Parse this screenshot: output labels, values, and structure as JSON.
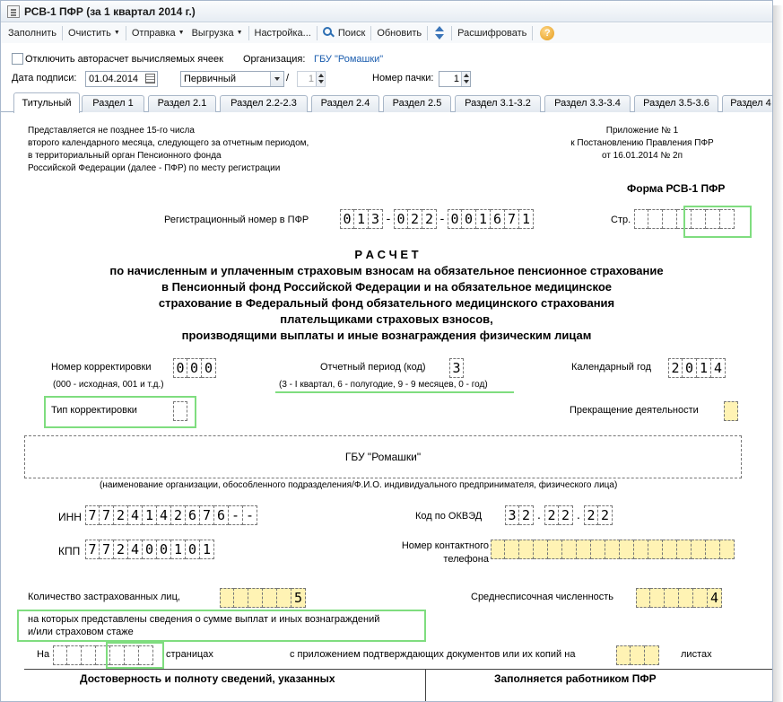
{
  "window": {
    "title": "РСВ-1 ПФР (за 1 квартал 2014 г.)"
  },
  "toolbar": {
    "fill": "Заполнить",
    "clear": "Очистить",
    "send": "Отправка",
    "export": "Выгрузка",
    "settings": "Настройка...",
    "search": "Поиск",
    "refresh": "Обновить",
    "decode": "Расшифровать"
  },
  "options": {
    "autocalc_label": "Отключить авторасчет вычисляемых ячеек",
    "org_label": "Организация:",
    "org_value": "ГБУ \"Ромашки\"",
    "sign_date_label": "Дата подписи:",
    "sign_date_value": "01.04.2014",
    "type_value": "Первичный",
    "type_sep": "/",
    "corr_num_value": "1",
    "pack_label": "Номер пачки:",
    "pack_value": "1"
  },
  "tabs": [
    "Титульный",
    "Раздел 1",
    "Раздел 2.1",
    "Раздел 2.2-2.3",
    "Раздел 2.4",
    "Раздел 2.5",
    "Раздел 3.1-3.2",
    "Раздел 3.3-3.4",
    "Раздел 3.5-3.6",
    "Раздел 4"
  ],
  "doc": {
    "note_lines": [
      "Представляется не позднее 15-го числа",
      "второго календарного месяца, следующего за отчетным периодом,",
      "в территориальный орган Пенсионного фонда",
      "Российской Федерации (далее - ПФР) по месту регистрации"
    ],
    "appendix_lines": [
      "Приложение № 1",
      "к Постановлению Правления ПФР",
      "от 16.01.2014 № 2п"
    ],
    "form_name": "Форма РСВ-1 ПФР",
    "reg_label": "Регистрационный номер в ПФР",
    "reg_digits": [
      [
        "0",
        "1",
        "3"
      ],
      [
        "0",
        "2",
        "2"
      ],
      [
        "0",
        "0",
        "1",
        "6",
        "7",
        "1"
      ]
    ],
    "reg_sep": "-",
    "page_label": "Стр.",
    "title_lines": [
      "Р А С Ч Е Т",
      "по начисленным и уплаченным страховым взносам на обязательное пенсионное страхование",
      "в Пенсионный фонд Российской Федерации и на обязательное медицинское",
      "страхование в Федеральный фонд обязательного медицинского страхования",
      "плательщиками страховых взносов,",
      "производящими выплаты и иные вознаграждения физическим лицам"
    ],
    "corr_num_label": "Номер корректировки",
    "corr_num_digits": [
      "0",
      "0",
      "0"
    ],
    "corr_hint": "(000 - исходная, 001 и т.д.)",
    "period_label": "Отчетный период (код)",
    "period_value": "3",
    "period_hint": "(3 - I квартал, 6 - полугодие, 9 - 9 месяцев, 0 - год)",
    "year_label": "Календарный год",
    "year_digits": [
      "2",
      "0",
      "1",
      "4"
    ],
    "corr_type_label": "Тип корректировки",
    "stop_label": "Прекращение деятельности",
    "org_name": "ГБУ \"Ромашки\"",
    "org_hint": "(наименование организации, обособленного подразделения/Ф.И.О. индивидуального предпринимателя, физического лица)",
    "inn_label": "ИНН",
    "inn_digits": [
      "7",
      "7",
      "2",
      "4",
      "1",
      "4",
      "2",
      "6",
      "7",
      "6",
      "-",
      "-"
    ],
    "okved_label": "Код по ОКВЭД",
    "okved_groups": [
      [
        "3",
        "2"
      ],
      [
        "2",
        "2"
      ],
      [
        "2",
        "2"
      ]
    ],
    "okved_sep": ".",
    "kpp_label": "КПП",
    "kpp_digits": [
      "7",
      "7",
      "2",
      "4",
      "0",
      "0",
      "1",
      "0",
      "1"
    ],
    "phone_label_1": "Номер контактного",
    "phone_label_2": "телефона",
    "insured_label": "Количество застрахованных лиц,",
    "insured_digits": [
      "",
      "",
      "",
      "",
      "",
      "5"
    ],
    "avg_label": "Среднесписочная численность",
    "avg_digits": [
      "",
      "",
      "",
      "",
      "",
      "4"
    ],
    "insured_hint_1": "на которых представлены сведения о сумме выплат и иных вознаграждений",
    "insured_hint_2": "и/или страховом стаже",
    "pages_prefix": "На",
    "pages_suffix": "страницах",
    "attach_label": "с приложением подтверждающих документов или их копий на",
    "sheets_label": "листах",
    "footer_left": "Достоверность и полноту сведений, указанных",
    "footer_right": "Заполняется работником ПФР"
  }
}
